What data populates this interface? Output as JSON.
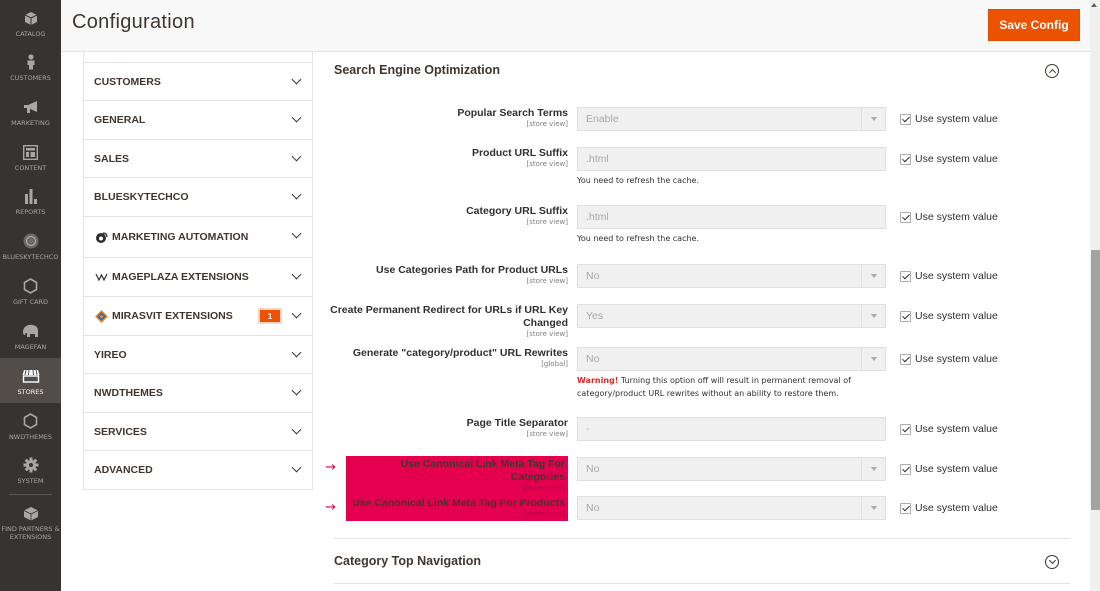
{
  "admin_menu": {
    "items": [
      {
        "label": "CATALOG",
        "icon": "box-icon"
      },
      {
        "label": "CUSTOMERS",
        "icon": "person-icon"
      },
      {
        "label": "MARKETING",
        "icon": "megaphone-icon"
      },
      {
        "label": "CONTENT",
        "icon": "layout-icon"
      },
      {
        "label": "REPORTS",
        "icon": "bar-chart-icon"
      },
      {
        "label": "BLUESKYTECHCO",
        "icon": "seal-icon"
      },
      {
        "label": "GIFT CARD",
        "icon": "hexagon-icon"
      },
      {
        "label": "MAGEFAN",
        "icon": "elephant-icon"
      },
      {
        "label": "STORES",
        "icon": "storefront-icon",
        "active": true
      },
      {
        "label": "NWDTHEMES",
        "icon": "hexagon-icon"
      },
      {
        "label": "SYSTEM",
        "icon": "gear-icon"
      },
      {
        "label": "FIND PARTNERS & EXTENSIONS",
        "icon": "blocks-icon"
      }
    ]
  },
  "header": {
    "title": "Configuration",
    "save_label": "Save Config",
    "accent": "#eb5202"
  },
  "tabs": [
    {
      "label": "CUSTOMERS"
    },
    {
      "label": "GENERAL"
    },
    {
      "label": "SALES"
    },
    {
      "label": "BLUESKYTECHCO"
    },
    {
      "label": "MARKETING AUTOMATION",
      "icon": "marketing-automation-icon"
    },
    {
      "label": "MAGEPLAZA EXTENSIONS",
      "icon": "mageplaza-icon"
    },
    {
      "label": "MIRASVIT EXTENSIONS",
      "icon": "mirasvit-icon",
      "badge": "1"
    },
    {
      "label": "YIREO"
    },
    {
      "label": "NWDTHEMES"
    },
    {
      "label": "SERVICES"
    },
    {
      "label": "ADVANCED"
    }
  ],
  "section": {
    "title": "Search Engine Optimization",
    "next_section_title": "Category Top Navigation",
    "system_value_label": "Use system value",
    "fields": [
      {
        "label": "Popular Search Terms",
        "scope": "[store view]",
        "type": "select",
        "value": "Enable",
        "use_system": true
      },
      {
        "label": "Product URL Suffix",
        "scope": "[store view]",
        "type": "text",
        "value": ".html",
        "note": "You need to refresh the cache.",
        "use_system": true
      },
      {
        "label": "Category URL Suffix",
        "scope": "[store view]",
        "type": "text",
        "value": ".html",
        "note": "You need to refresh the cache.",
        "use_system": true
      },
      {
        "label": "Use Categories Path for Product URLs",
        "scope": "[store view]",
        "type": "select",
        "value": "No",
        "use_system": true
      },
      {
        "label": "Create Permanent Redirect for URLs if URL Key Changed",
        "scope": "[store view]",
        "type": "select",
        "value": "Yes",
        "use_system": true
      },
      {
        "label": "Generate \"category/product\" URL Rewrites",
        "scope": "[global]",
        "type": "select",
        "value": "No",
        "warning_label": "Warning!",
        "warning_text": " Turning this option off will result in permanent removal of category/product URL rewrites without an ability to restore them.",
        "use_system": true
      },
      {
        "label": "Page Title Separator",
        "scope": "[store view]",
        "type": "text",
        "value": "-",
        "use_system": true
      },
      {
        "label": "Use Canonical Link Meta Tag For Categories",
        "scope": "[store view]",
        "type": "select",
        "value": "No",
        "highlighted": true,
        "use_system": true
      },
      {
        "label": "Use Canonical Link Meta Tag For Products",
        "scope": "[store view]",
        "type": "select",
        "value": "No",
        "highlighted": true,
        "use_system": true
      }
    ],
    "highlight_color": "#e5004f",
    "pointer_glyph": "→"
  }
}
